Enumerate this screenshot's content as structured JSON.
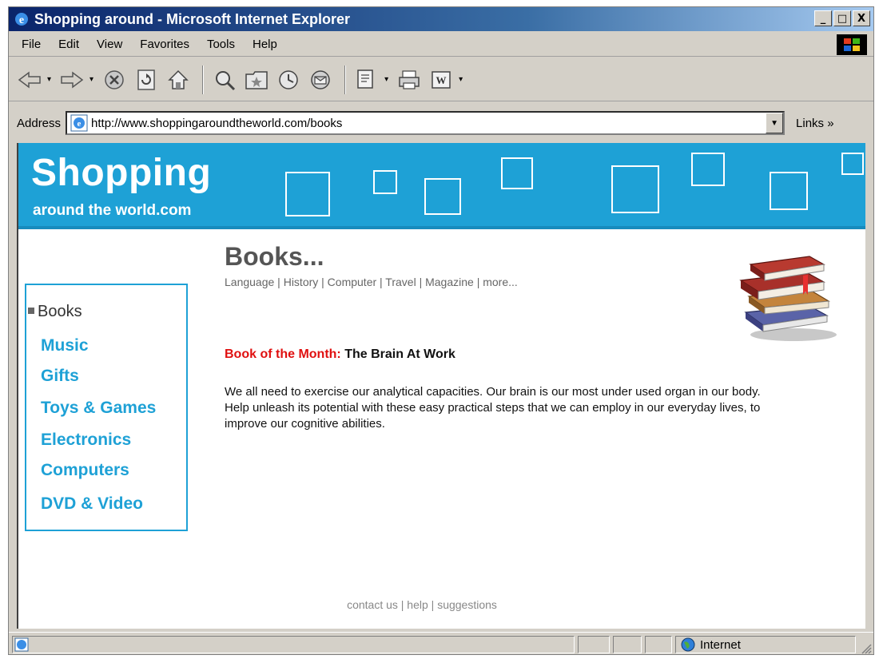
{
  "window": {
    "title": "Shopping around - Microsoft Internet Explorer",
    "buttons": {
      "minimize": "_",
      "maximize": "□",
      "close": "X"
    }
  },
  "menu": {
    "items": [
      "File",
      "Edit",
      "View",
      "Favorites",
      "Tools",
      "Help"
    ]
  },
  "toolbar": {
    "icons": [
      "back-icon",
      "forward-icon",
      "stop-icon",
      "refresh-icon",
      "home-icon",
      "search-icon",
      "favorites-icon",
      "history-icon",
      "mail-icon",
      "print-icon",
      "word-icon"
    ]
  },
  "address": {
    "label": "Address",
    "url": "http://www.shoppingaroundtheworld.com/books",
    "links_label": "Links »"
  },
  "site": {
    "name": "Shopping",
    "subtitle": "around the world.com",
    "banner_color": "#1ea1d6"
  },
  "sidebar": {
    "current": "Books",
    "items": [
      "Music",
      "Gifts",
      "Toys & Games",
      "Electronics",
      "Computers",
      "DVD & Video"
    ]
  },
  "main": {
    "title": "Books...",
    "subnav": "Language | History | Computer | Travel | Magazine | more...",
    "book_of_month_label": "Book of the Month:",
    "book_of_month_title": "The Brain At Work",
    "description": "We all need to exercise our analytical capacities. Our brain is our most under used organ in our body. Help unleash its potential with these easy practical steps that we can employ in our everyday lives, to improve our cognitive abilities."
  },
  "footer": {
    "text": "contact us | help | suggestions"
  },
  "statusbar": {
    "zone": "Internet"
  },
  "colors": {
    "accent": "#1ea1d6",
    "highlight": "#e01010"
  }
}
